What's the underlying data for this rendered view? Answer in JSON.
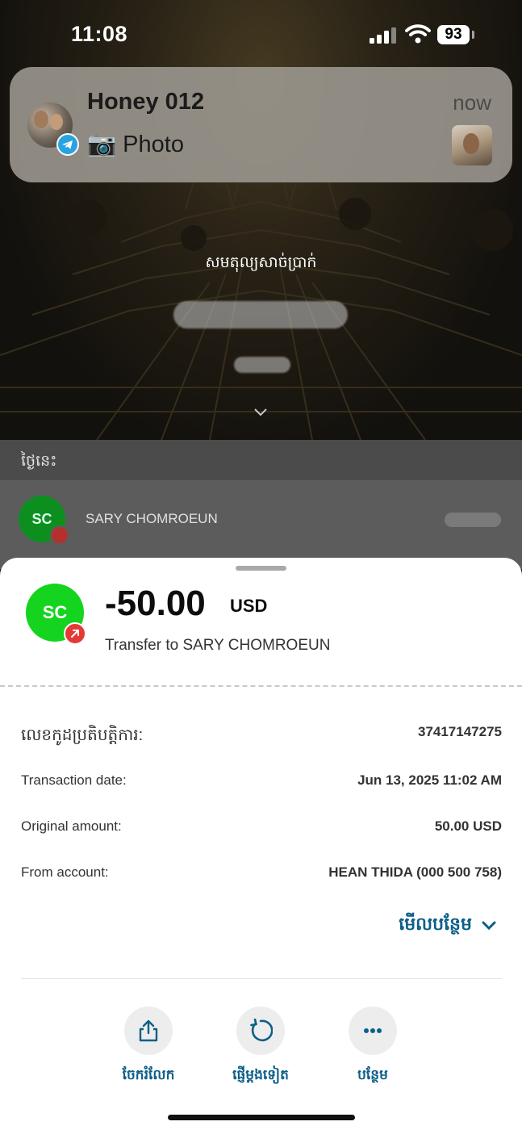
{
  "status_bar": {
    "time": "11:08",
    "battery": "93"
  },
  "notification": {
    "title": "Honey 012",
    "body": "📷 Photo",
    "time": "now",
    "app_icon": "telegram-icon"
  },
  "background_app": {
    "balance_label": "សមតុល្យសាច់ប្រាក់",
    "today_label": "ថ្ងៃនេះ",
    "row": {
      "initials": "SC",
      "name": "SARY CHOMROEUN"
    }
  },
  "transaction": {
    "initials": "SC",
    "amount": "-50.00",
    "currency": "USD",
    "description": "Transfer to SARY CHOMROEUN",
    "colors": {
      "avatar": "#15d41f",
      "badge": "#e53935"
    },
    "details": [
      {
        "label": "លេខកូដប្រតិបត្តិការ:",
        "value": "37417147275"
      },
      {
        "label": "Transaction date:",
        "value": "Jun 13, 2025 11:02 AM"
      },
      {
        "label": "Original amount:",
        "value": "50.00 USD"
      },
      {
        "label": "From account:",
        "value": "HEAN THIDA (000 500 758)"
      }
    ],
    "see_more": "មើលបន្ថែម"
  },
  "actions": [
    {
      "label": "ចែករំលែក",
      "icon": "share-icon"
    },
    {
      "label": "ផ្ញើម្តងទៀត",
      "icon": "repeat-icon"
    },
    {
      "label": "បន្ថែម",
      "icon": "more-icon"
    }
  ],
  "accent_color": "#0d5f88"
}
